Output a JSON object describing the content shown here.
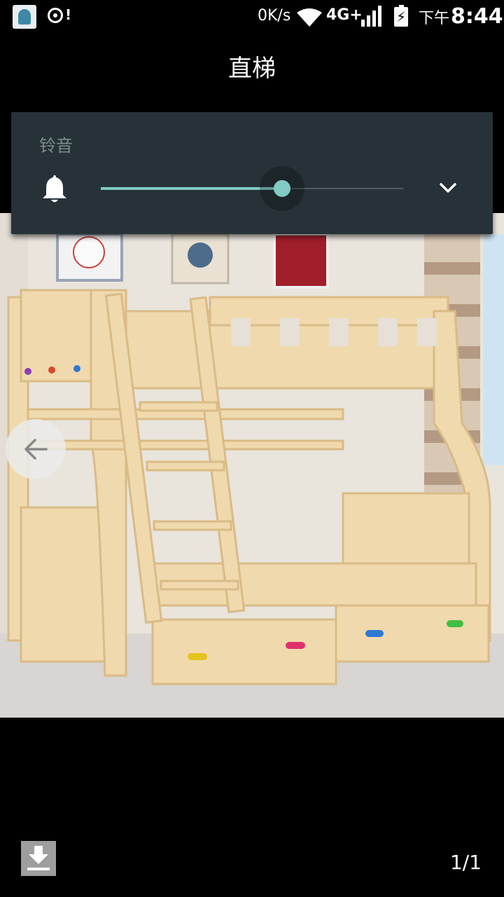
{
  "status_bar": {
    "speed": "0K/s",
    "network": "4G+",
    "ampm": "下午",
    "time": "8:44",
    "icons": [
      "app-icon",
      "disc-icon",
      "wifi-icon",
      "signal-icon",
      "battery-charging-icon"
    ]
  },
  "header": {
    "title": "直梯"
  },
  "volume_panel": {
    "label": "铃音",
    "level": 0.6,
    "icons": [
      "bell-icon",
      "chevron-down-icon"
    ],
    "accent_color": "#80cbc4",
    "panel_color": "#263238"
  },
  "viewer": {
    "image_description_icon": "bunk-bed-photo",
    "back_icon": "arrow-left-icon",
    "download_icon": "download-icon",
    "page_counter": "1/1"
  }
}
